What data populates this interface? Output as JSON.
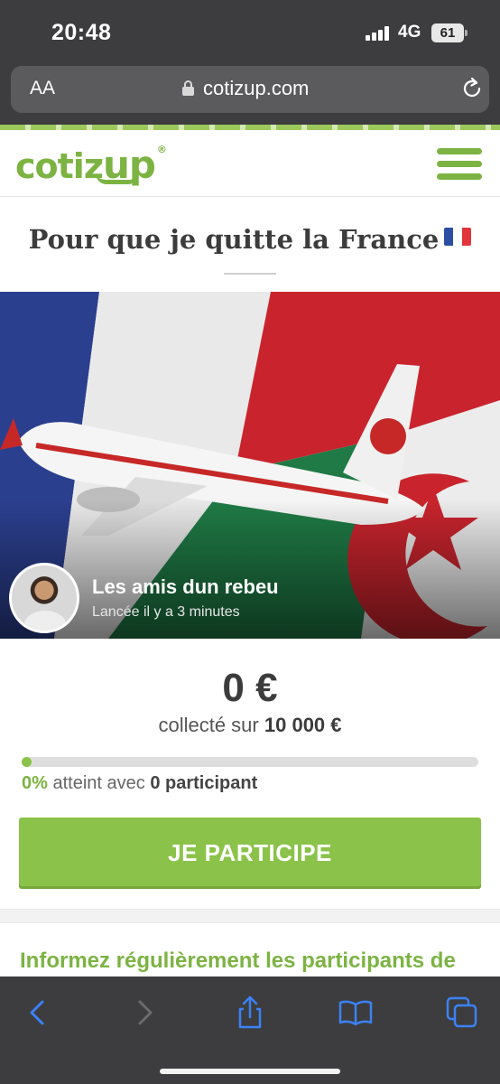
{
  "status_bar": {
    "time": "20:48",
    "network": "4G",
    "battery": "61"
  },
  "browser": {
    "text_size_label": "AA",
    "url": "cotizup.com"
  },
  "site": {
    "logo_text_a": "cotiz",
    "logo_text_b": "up",
    "logo_reg": "®"
  },
  "campaign": {
    "title": "Pour que je quitte la France",
    "title_flag": "france-flag",
    "organizer_name": "Les amis dun rebeu",
    "launched": "Lancée il y a 3 minutes",
    "amount": "0 €",
    "goal_prefix": "collecté sur",
    "goal_amount": "10 000 €",
    "progress_fraction": 0,
    "reached_pct": "0%",
    "reached_text": "atteint avec",
    "participants": "0 participant",
    "cta_label": "JE PARTICIPE",
    "info_heading": "Informez régulièrement les participants de"
  },
  "colors": {
    "brand_green": "#8bc34a",
    "browser_chrome": "#3d3d3f"
  },
  "icons": [
    "lock-icon",
    "reload-icon",
    "menu-icon",
    "back-icon",
    "forward-icon",
    "share-icon",
    "bookmarks-icon",
    "tabs-icon"
  ]
}
